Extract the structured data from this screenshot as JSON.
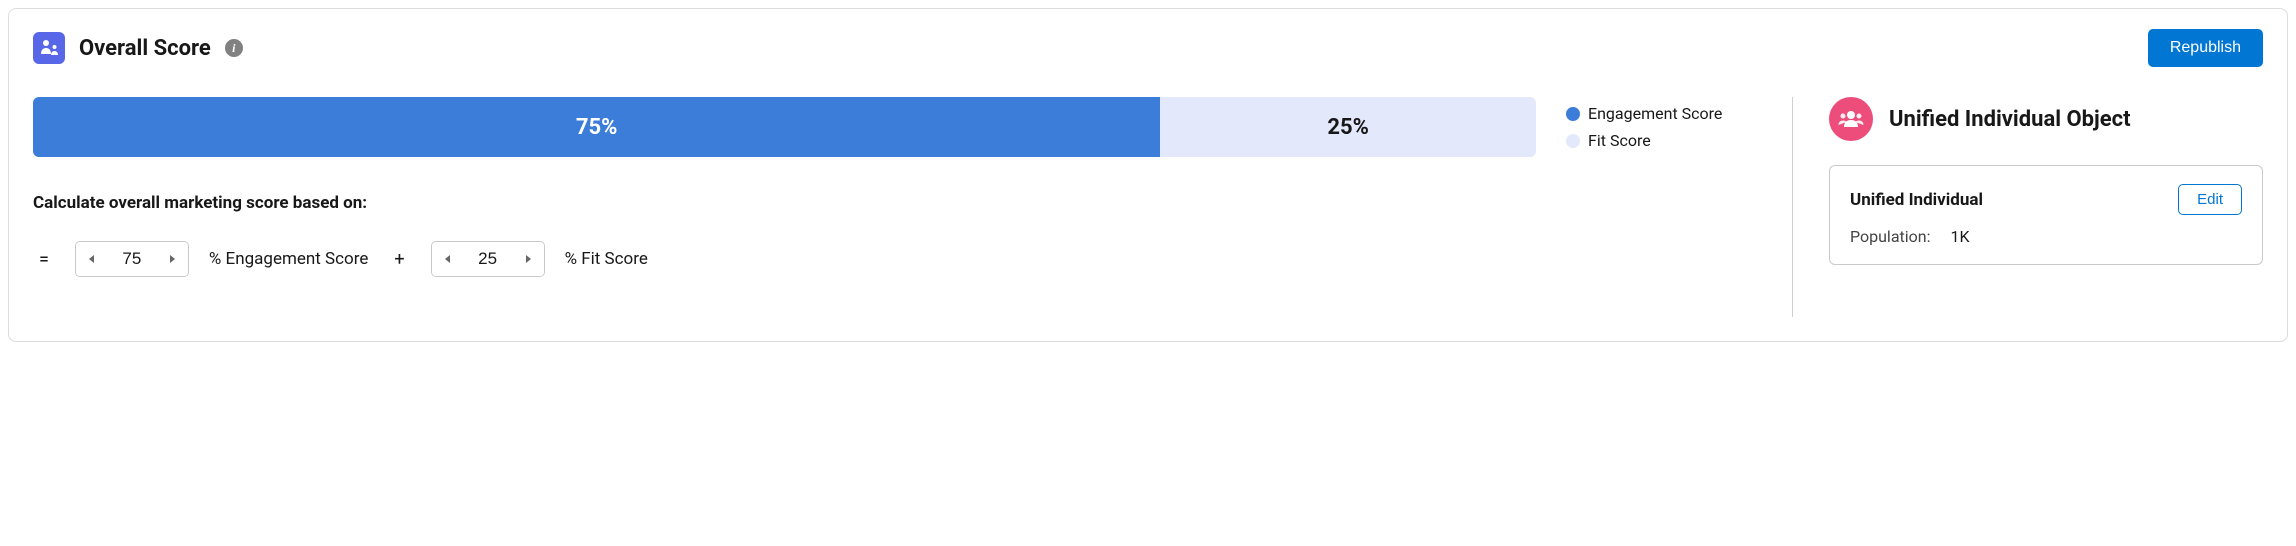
{
  "header": {
    "title": "Overall Score",
    "republish_label": "Republish"
  },
  "score_bar": {
    "engagement_pct": 75,
    "engagement_display": "75%",
    "fit_pct": 25,
    "fit_display": "25%"
  },
  "legend": {
    "engagement": "Engagement Score",
    "fit": "Fit Score"
  },
  "formula": {
    "label": "Calculate overall marketing score based on:",
    "equals": "=",
    "plus": "+",
    "engagement_value": "75",
    "engagement_text": "% Engagement Score",
    "fit_value": "25",
    "fit_text": "% Fit Score"
  },
  "right_panel": {
    "title": "Unified Individual Object",
    "card_title": "Unified Individual",
    "population_label": "Population:",
    "population_value": "1K",
    "edit_label": "Edit"
  },
  "colors": {
    "engagement": "#3b7dd8",
    "fit_bg": "#e3e8fb",
    "primary_btn": "#0176d3",
    "link": "#0176d3",
    "pink": "#ec4d7b",
    "icon_purple": "#5867e8"
  },
  "chart_data": {
    "type": "bar",
    "title": "Overall Score",
    "categories": [
      "Engagement Score",
      "Fit Score"
    ],
    "values": [
      75,
      25
    ],
    "ylim": [
      0,
      100
    ],
    "ylabel": "%"
  }
}
